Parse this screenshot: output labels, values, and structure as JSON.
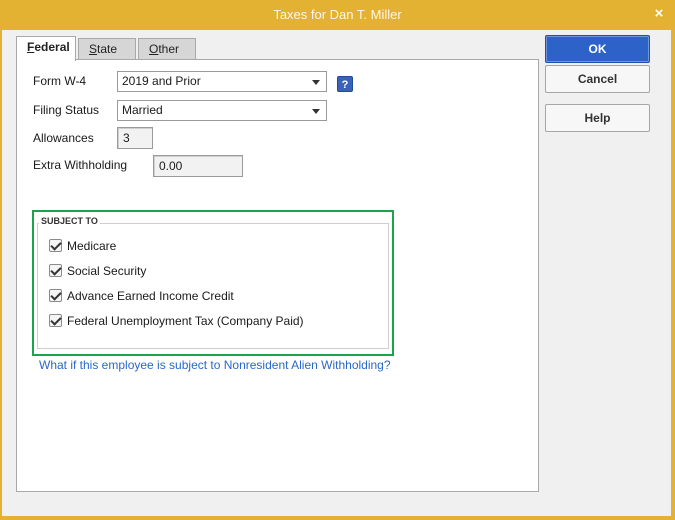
{
  "window": {
    "title": "Taxes for Dan T. Miller",
    "close_symbol": "×",
    "border_color": "#e3b233"
  },
  "tabs": [
    {
      "label_first": "F",
      "label_rest": "ederal",
      "active": true
    },
    {
      "label_first": "S",
      "label_rest": "tate",
      "active": false
    },
    {
      "label_first": "O",
      "label_rest": "ther",
      "active": false
    }
  ],
  "form": {
    "w4_label": "Form W-4",
    "w4_value": "2019 and Prior",
    "help_symbol": "?",
    "filing_status_label": "Filing Status",
    "filing_status_value": "Married",
    "allowances_label": "Allowances",
    "allowances_value": "3",
    "extra_withholding_label": "Extra Withholding",
    "extra_withholding_value": "0.00"
  },
  "subject_to": {
    "title": "SUBJECT TO",
    "highlight_color": "#1ea34a",
    "items": [
      {
        "label": "Medicare",
        "checked": true
      },
      {
        "label": "Social Security",
        "checked": true
      },
      {
        "label": "Advance Earned Income Credit",
        "checked": true
      },
      {
        "label": "Federal Unemployment Tax (Company Paid)",
        "checked": true
      }
    ]
  },
  "link": {
    "text": "What if this employee is subject to Nonresident Alien Withholding?",
    "color": "#2a67c9"
  },
  "buttons": {
    "ok": "OK",
    "cancel": "Cancel",
    "help": "Help",
    "primary_color": "#2d63c8"
  }
}
